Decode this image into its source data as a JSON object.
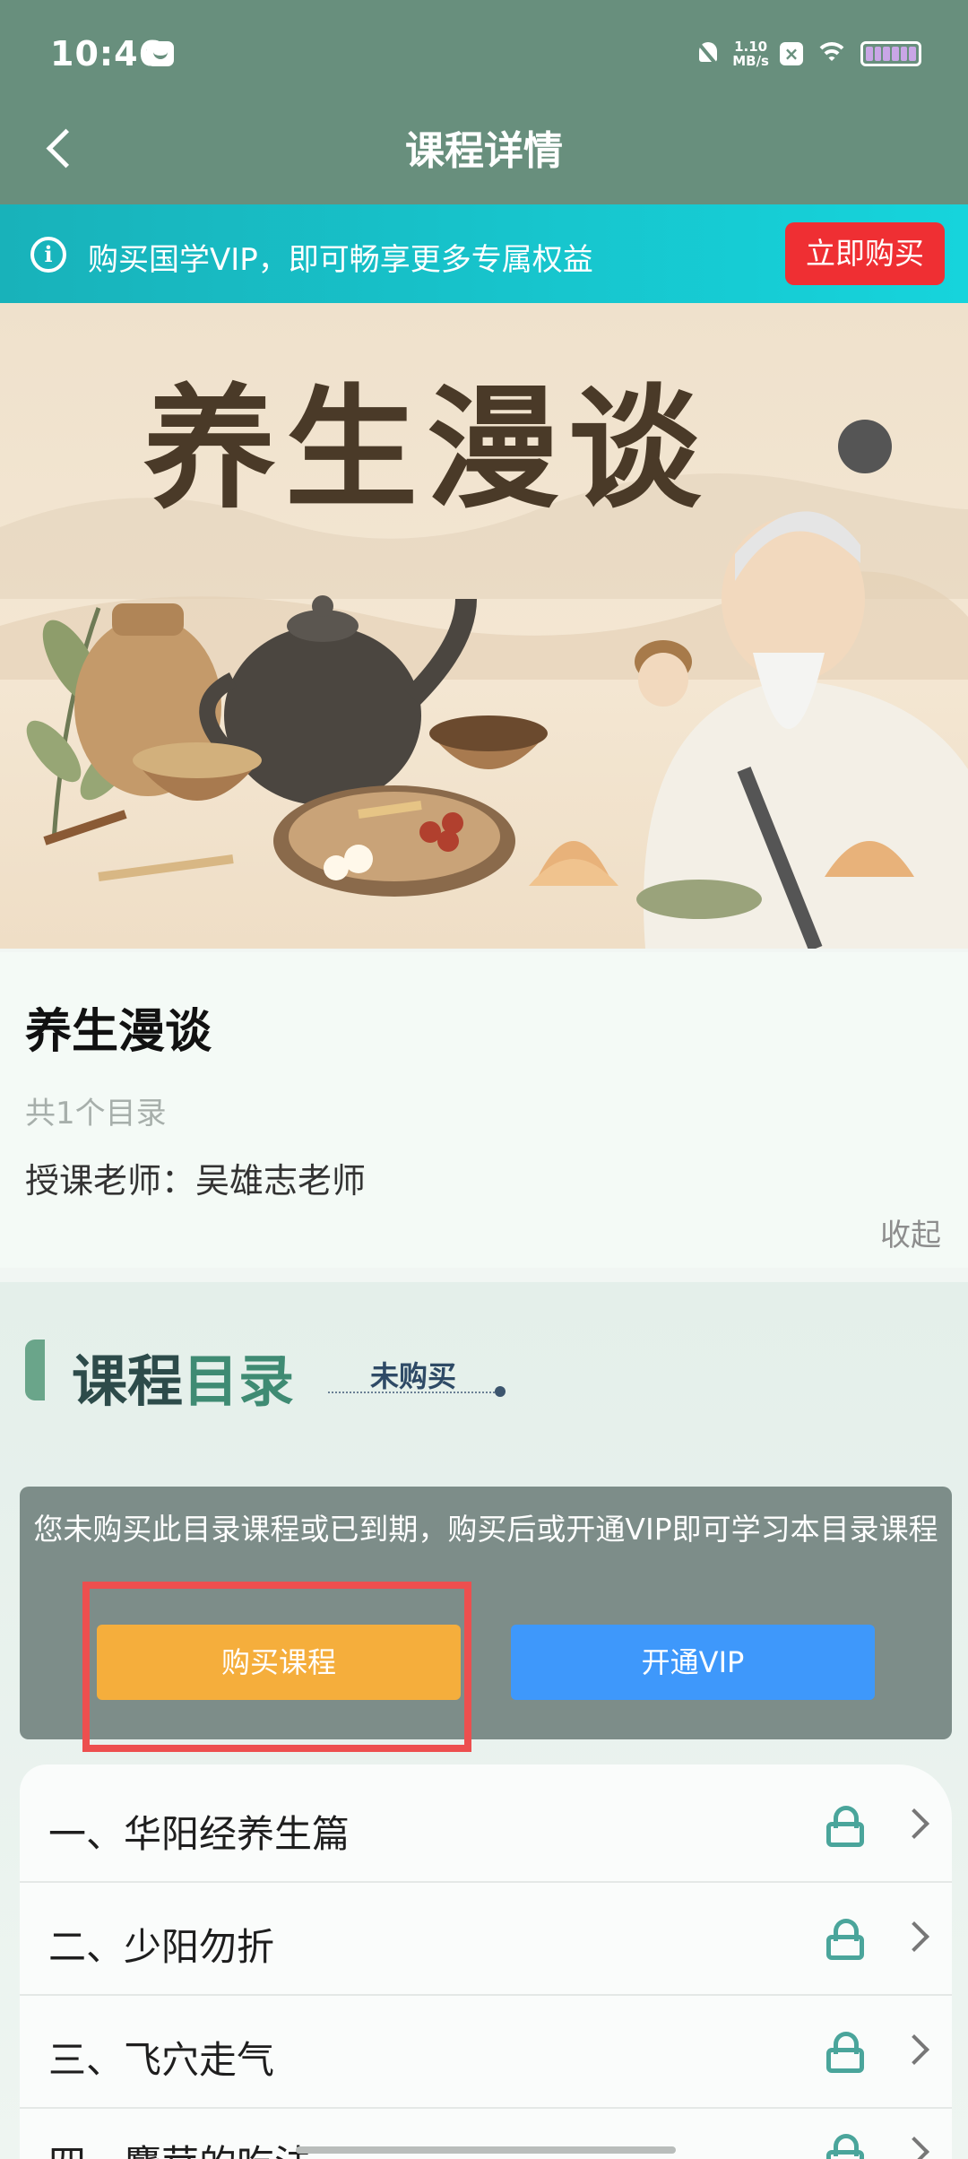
{
  "status_bar": {
    "time": "10:46",
    "speed_value": "1.10",
    "speed_unit": "MB/s"
  },
  "header": {
    "title": "课程详情"
  },
  "vip_banner": {
    "info_icon_glyph": "i",
    "text": "购买国学VIP，即可畅享更多专属权益",
    "button": "立即购买"
  },
  "hero": {
    "title": "养生漫谈"
  },
  "course": {
    "title": "养生漫谈",
    "directory_count": "共1个目录",
    "teacher": "授课老师：吴雄志老师",
    "collapse": "收起"
  },
  "catalog": {
    "title_a": "课程",
    "title_b": "目录",
    "status": "未购买",
    "lock_message": "您未购买此目录课程或已到期，购买后或开通VIP即可学习本目录课程",
    "buy_button": "购买课程",
    "vip_button": "开通VIP",
    "items": [
      {
        "label": "一、华阳经养生篇"
      },
      {
        "label": "二、少阳勿折"
      },
      {
        "label": "三、飞穴走气"
      },
      {
        "label": "四、麝茸的吃法"
      }
    ]
  },
  "colors": {
    "header_bg": "#688f7d",
    "vip_banner": "#16d4dc",
    "buy_now": "#ef2f33",
    "buy_course": "#f5ae3c",
    "open_vip": "#3e98fb",
    "highlight": "#ed4f4f",
    "lock_icon": "#4aa59b"
  }
}
